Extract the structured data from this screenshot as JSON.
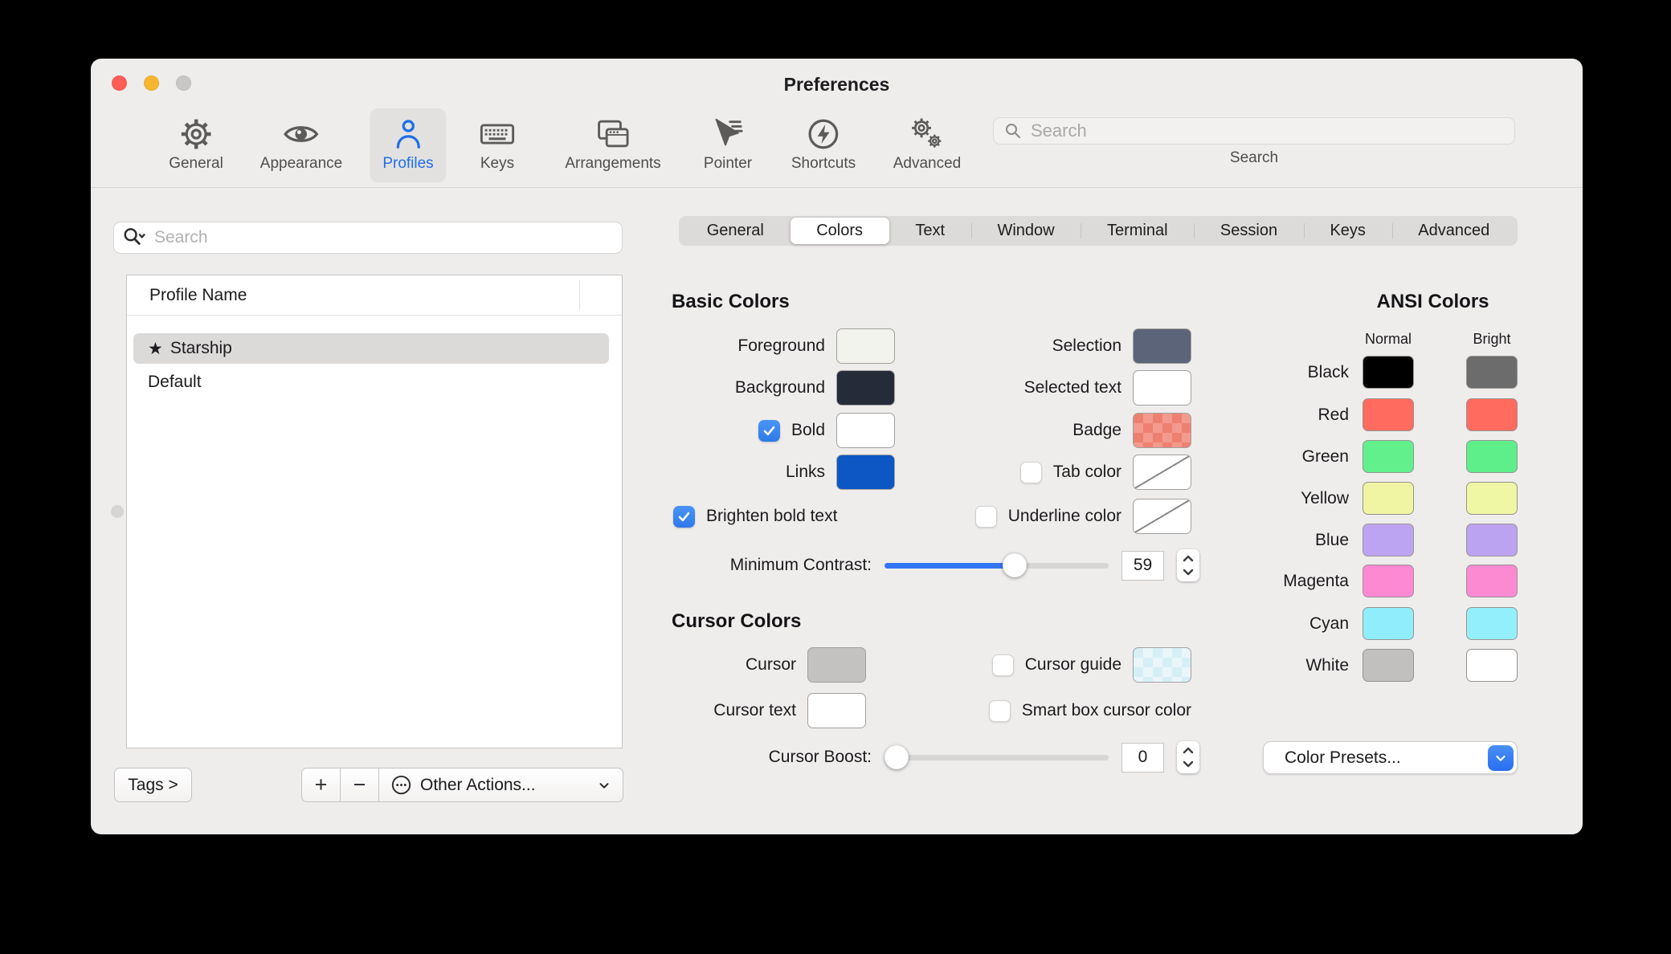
{
  "window": {
    "title": "Preferences"
  },
  "traffic_lights": {
    "close": "#ff5d55",
    "minimize": "#f5b52e",
    "zoom": "#c9c7c5"
  },
  "toolbar": {
    "items": [
      {
        "label": "General"
      },
      {
        "label": "Appearance"
      },
      {
        "label": "Profiles"
      },
      {
        "label": "Keys"
      },
      {
        "label": "Arrangements"
      },
      {
        "label": "Pointer"
      },
      {
        "label": "Shortcuts"
      },
      {
        "label": "Advanced"
      }
    ],
    "search": {
      "placeholder": "Search",
      "caption": "Search"
    }
  },
  "sidebar": {
    "search_placeholder": "Search",
    "list_header": "Profile Name",
    "profiles": [
      {
        "star": "★",
        "name": "Starship"
      },
      {
        "star": "",
        "name": "Default"
      }
    ],
    "tags_button": "Tags >",
    "add_button": "+",
    "remove_button": "−",
    "other_actions": "Other Actions..."
  },
  "tabs": {
    "items": [
      "General",
      "Colors",
      "Text",
      "Window",
      "Terminal",
      "Session",
      "Keys",
      "Advanced"
    ],
    "selected": "Colors"
  },
  "basic_colors": {
    "heading": "Basic Colors",
    "foreground": {
      "label": "Foreground",
      "color": "#f3f3ed"
    },
    "background": {
      "label": "Background",
      "color": "#262b39"
    },
    "bold": {
      "label": "Bold",
      "checked": true,
      "color": "#ffffff"
    },
    "links": {
      "label": "Links",
      "color": "#0d57c5"
    },
    "selection": {
      "label": "Selection",
      "color": "#5b6478"
    },
    "selected_text": {
      "label": "Selected text",
      "color": "#ffffff"
    },
    "badge": {
      "label": "Badge",
      "checker": [
        "#f29a8d",
        "#ee8071"
      ]
    },
    "tab_color": {
      "label": "Tab color",
      "checked": false
    },
    "brighten_bold": {
      "label": "Brighten bold text",
      "checked": true
    },
    "underline_color": {
      "label": "Underline color",
      "checked": false
    },
    "minimum_contrast": {
      "label": "Minimum Contrast:",
      "value": "59",
      "percent": 59
    }
  },
  "cursor_colors": {
    "heading": "Cursor Colors",
    "cursor": {
      "label": "Cursor",
      "color": "#c3c2c1"
    },
    "cursor_text": {
      "label": "Cursor text",
      "color": "#ffffff"
    },
    "cursor_guide": {
      "label": "Cursor guide",
      "checked": false,
      "checker": [
        "#eaf6fa",
        "#d6eff6"
      ]
    },
    "smart_box": {
      "label": "Smart box cursor color",
      "checked": false
    },
    "cursor_boost": {
      "label": "Cursor Boost:",
      "value": "0",
      "percent": 0
    }
  },
  "ansi": {
    "heading": "ANSI Colors",
    "columns": [
      "Normal",
      "Bright"
    ],
    "rows": [
      {
        "label": "Black",
        "normal": "#000000",
        "bright": "#6d6c6c"
      },
      {
        "label": "Red",
        "normal": "#ff6b5e",
        "bright": "#ff6b5e"
      },
      {
        "label": "Green",
        "normal": "#61f08c",
        "bright": "#5eef8a"
      },
      {
        "label": "Yellow",
        "normal": "#eff5a2",
        "bright": "#eff6a4"
      },
      {
        "label": "Blue",
        "normal": "#bca4f3",
        "bright": "#bba3f2"
      },
      {
        "label": "Magenta",
        "normal": "#fc89d2",
        "bright": "#fc8ad3"
      },
      {
        "label": "Cyan",
        "normal": "#90edfb",
        "bright": "#94effc"
      },
      {
        "label": "White",
        "normal": "#c1c0bf",
        "bright": "#ffffff"
      }
    ],
    "presets_button": "Color Presets..."
  },
  "accent": {
    "checkbox_blue": "#3a82f7",
    "slider_blue": "#3276f5",
    "selected_tab_text": "#1f6fe6"
  }
}
